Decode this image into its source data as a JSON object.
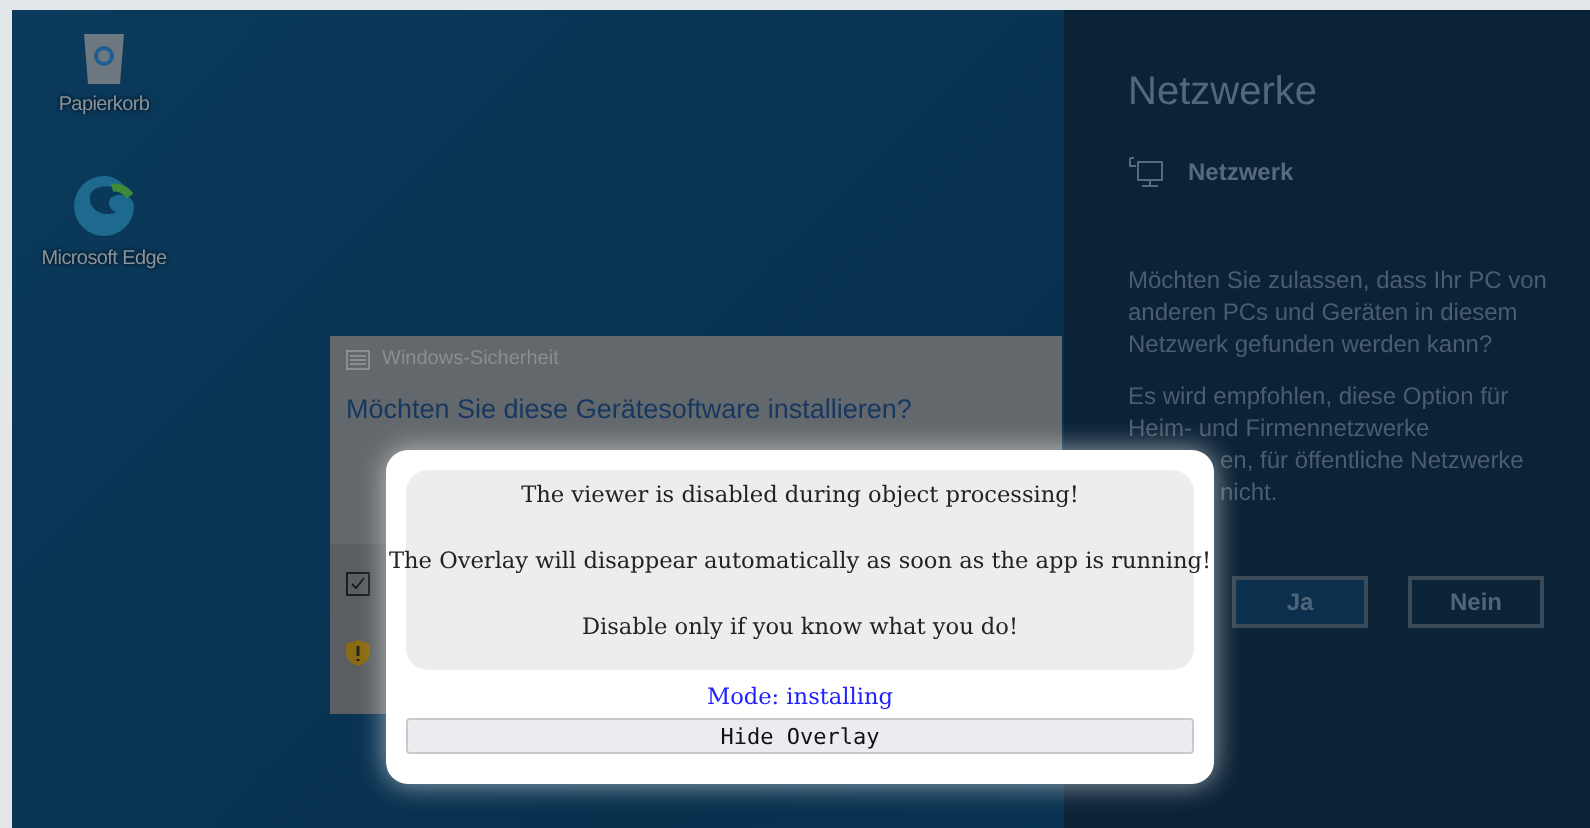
{
  "desktop": {
    "icons": [
      {
        "label": "Papierkorb",
        "kind": "recycle-bin"
      },
      {
        "label": "Microsoft Edge",
        "kind": "browser"
      }
    ]
  },
  "security_dialog": {
    "title": "Windows-Sicherheit",
    "heading": "Möchten Sie diese Gerätesoftware installieren?"
  },
  "network_panel": {
    "title": "Netzwerke",
    "network": "Netzwerk",
    "question": "Möchten Sie zulassen, dass Ihr PC von anderen PCs und Geräten in diesem Netzwerk gefunden werden kann?",
    "recommendation_lines": [
      {
        "text": "Es wird empfohlen, diese Option für",
        "kind": "full"
      },
      {
        "text": "Heim- und Firmennetzwerke",
        "kind": "full"
      },
      {
        "text": "en, für öffentliche Netzwerke",
        "kind": "cut"
      },
      {
        "text": "nicht.",
        "kind": "cut"
      }
    ],
    "buttons": [
      "Ja",
      "Nein"
    ]
  },
  "overlay": {
    "messages": [
      "The viewer is disabled during object processing!",
      "The Overlay will disappear automatically as soon as the app is running!",
      "Disable only if you know what you do!"
    ],
    "mode": "Mode: installing",
    "button": "Hide Overlay"
  }
}
